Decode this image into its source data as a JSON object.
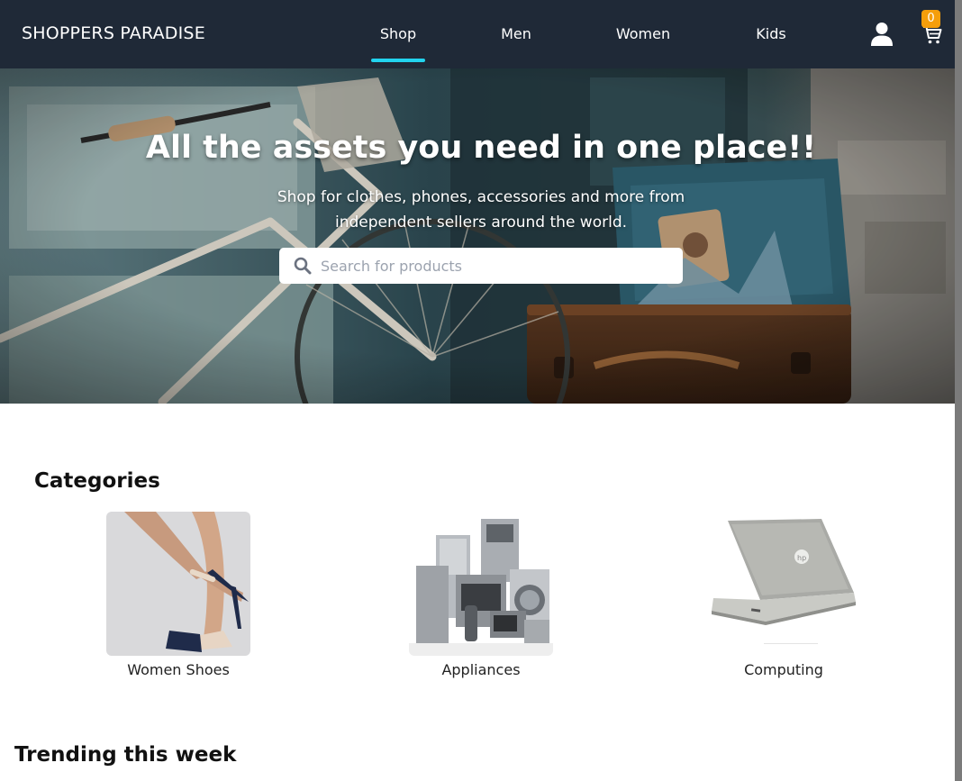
{
  "navbar": {
    "brand": "SHOPPERS PARADISE",
    "links": [
      {
        "label": "Shop",
        "active": true
      },
      {
        "label": "Men",
        "active": false
      },
      {
        "label": "Women",
        "active": false
      },
      {
        "label": "Kids",
        "active": false
      }
    ],
    "cart_count": "0",
    "accent_color": "#22d3ee",
    "badge_color": "#f59e0b",
    "background_color": "#1f2937"
  },
  "hero": {
    "title": "All the assets you need in one place!!",
    "subtitle": "Shop for clothes, phones, accessories and more from independent sellers around the world.",
    "search_placeholder": "Search for products",
    "search_value": ""
  },
  "categories": {
    "title": "Categories",
    "items": [
      {
        "label": "Women Shoes",
        "icon": "shoe-image"
      },
      {
        "label": "Appliances",
        "icon": "appliances-image"
      },
      {
        "label": "Computing",
        "icon": "laptop-image"
      }
    ]
  },
  "trending": {
    "title": "Trending this week"
  }
}
